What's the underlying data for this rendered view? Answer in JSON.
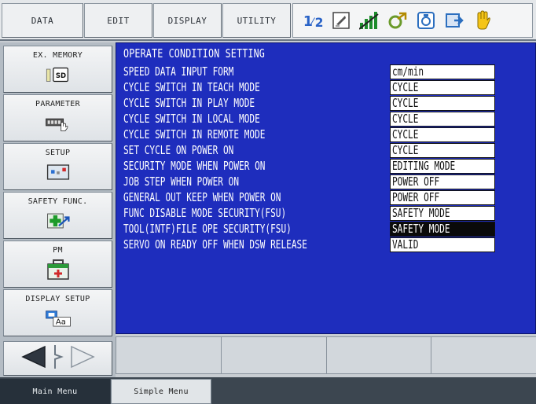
{
  "menu_bar": {
    "tabs": [
      "DATA",
      "EDIT",
      "DISPLAY",
      "UTILITY"
    ],
    "status_icons": [
      "coordinate-1-2-icon",
      "edit-mode-icon",
      "signal-strength-icon",
      "servo-cycle-icon",
      "teach-pendant-icon",
      "play-arrow-icon",
      "hand-stop-icon"
    ]
  },
  "sidebar": {
    "items": [
      {
        "label": "EX. MEMORY",
        "icon": "sd-card-icon"
      },
      {
        "label": "PARAMETER",
        "icon": "parameter-hand-icon"
      },
      {
        "label": "SETUP",
        "icon": "setup-panel-icon"
      },
      {
        "label": "SAFETY FUNC.",
        "icon": "safety-arrow-icon"
      },
      {
        "label": "PM",
        "icon": "first-aid-icon"
      },
      {
        "label": "DISPLAY SETUP",
        "icon": "display-font-icon"
      }
    ],
    "icon_text": {
      "sd": "SD",
      "aa": "Aa"
    }
  },
  "main": {
    "title": "OPERATE CONDITION SETTING",
    "rows": [
      {
        "label": "SPEED DATA INPUT FORM",
        "value": "cm/min",
        "selected": false
      },
      {
        "label": "CYCLE SWITCH IN TEACH MODE",
        "value": "CYCLE",
        "selected": false
      },
      {
        "label": "CYCLE SWITCH IN PLAY MODE",
        "value": "CYCLE",
        "selected": false
      },
      {
        "label": "CYCLE SWITCH IN LOCAL MODE",
        "value": "CYCLE",
        "selected": false
      },
      {
        "label": "CYCLE SWITCH IN REMOTE MODE",
        "value": "CYCLE",
        "selected": false
      },
      {
        "label": "SET CYCLE ON POWER ON",
        "value": "CYCLE",
        "selected": false
      },
      {
        "label": "SECURITY MODE WHEN POWER ON",
        "value": "EDITING MODE",
        "selected": false
      },
      {
        "label": "JOB STEP WHEN POWER ON",
        "value": "POWER OFF",
        "selected": false
      },
      {
        "label": "GENERAL OUT KEEP WHEN POWER ON",
        "value": "POWER OFF",
        "selected": false
      },
      {
        "label": "FUNC DISABLE MODE SECURITY(FSU)",
        "value": "SAFETY MODE",
        "selected": false
      },
      {
        "label": "TOOL(INTF)FILE OPE SECURITY(FSU)",
        "value": "SAFETY MODE",
        "selected": true
      },
      {
        "label": "SERVO ON READY OFF WHEN DSW RELEASE",
        "value": "VALID",
        "selected": false
      }
    ]
  },
  "bottom_tabs": [
    "Main Menu",
    "Simple Menu"
  ],
  "colors": {
    "content_bg": "#1e2dbd",
    "selected_bg": "#0a0a0a",
    "bar_bg": "#3c4650"
  }
}
